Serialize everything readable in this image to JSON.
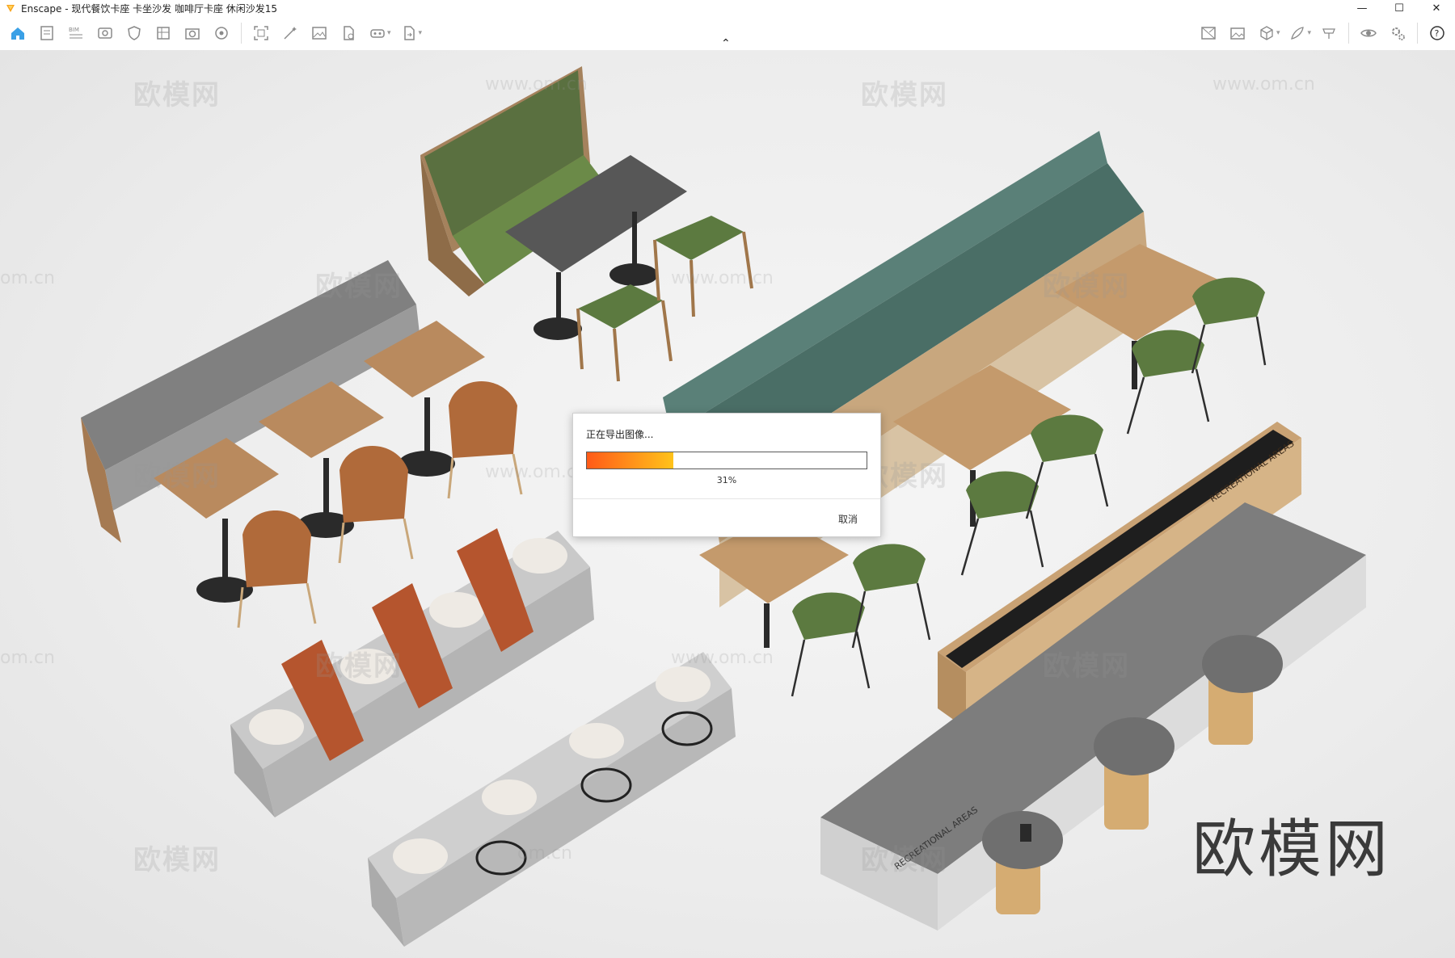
{
  "window": {
    "title": "Enscape - 现代餐饮卡座 卡坐沙发 咖啡厅卡座  休闲沙发15",
    "minimize_glyph": "—",
    "maximize_glyph": "☐",
    "close_glyph": "✕"
  },
  "toolbar": {
    "left_icons": [
      "home-icon",
      "document-icon",
      "bim-icon",
      "view-icon",
      "shield-icon",
      "library-icon",
      "upload-icon",
      "asset-icon",
      "capture-icon",
      "magic-icon",
      "image-icon",
      "file-icon",
      "vr-icon",
      "export-icon"
    ],
    "right_icons": [
      "material-icon",
      "image-gallery-icon",
      "cube-icon",
      "feather-icon",
      "camera-icon",
      "eye-icon",
      "settings-icon",
      "help-icon"
    ],
    "collapse_glyph": "⌃",
    "help_glyph": "?"
  },
  "viewport": {
    "watermark": "欧模网",
    "watermark_url": "www.om.cn",
    "watermark_url_partial": "om.cn",
    "brand_mark": "欧模网",
    "planter_label": "RECREATIONAL AREAS"
  },
  "dialog": {
    "title": "正在导出图像...",
    "progress": 0.31,
    "progress_label": "31%",
    "cancel_label": "取消"
  }
}
